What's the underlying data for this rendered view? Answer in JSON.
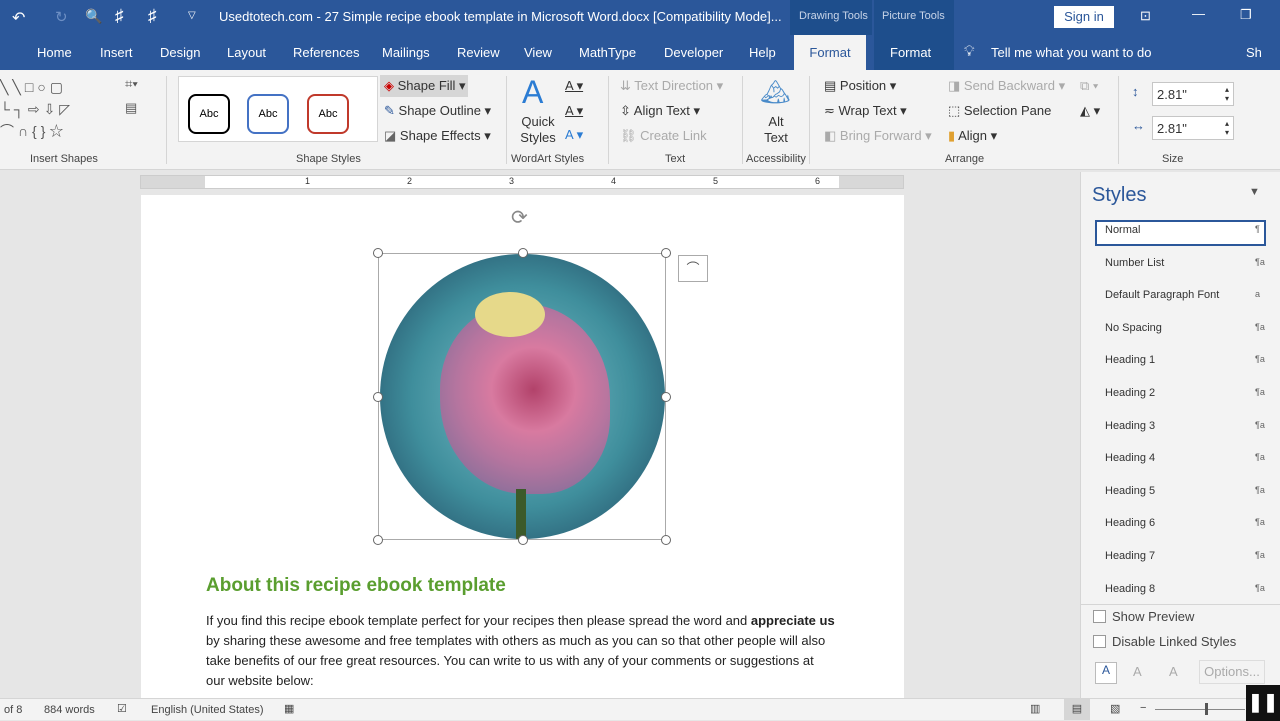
{
  "title_bar": {
    "document_title": "Usedtotech.com - 27 Simple recipe ebook template in Microsoft Word.docx [Compatibility Mode]...",
    "contextual_tabs": [
      "Drawing Tools",
      "Picture Tools"
    ],
    "sign_in": "Sign in"
  },
  "tabs": [
    "Home",
    "Insert",
    "Design",
    "Layout",
    "References",
    "Mailings",
    "Review",
    "View",
    "MathType",
    "Developer",
    "Help",
    "Format",
    "Format"
  ],
  "tell_me": "Tell me what you want to do",
  "share": "Sh",
  "ribbon": {
    "insert_shapes": "Insert Shapes",
    "shape_styles": {
      "label": "Shape Styles",
      "samples": [
        "Abc",
        "Abc",
        "Abc"
      ],
      "fill": "Shape Fill",
      "outline": "Shape Outline",
      "effects": "Shape Effects"
    },
    "wordart": {
      "label": "WordArt Styles",
      "quick_styles": "Quick Styles"
    },
    "text": {
      "label": "Text",
      "direction": "Text Direction",
      "align": "Align Text",
      "link": "Create Link"
    },
    "accessibility": {
      "label": "Accessibility",
      "alt_text": "Alt Text"
    },
    "arrange": {
      "label": "Arrange",
      "position": "Position",
      "wrap": "Wrap Text",
      "forward": "Bring Forward",
      "backward": "Send Backward",
      "selection": "Selection Pane",
      "align": "Align"
    },
    "size": {
      "label": "Size",
      "height": "2.81\"",
      "width": "2.81\""
    }
  },
  "ruler": [
    "1",
    "2",
    "3",
    "4",
    "5",
    "6"
  ],
  "document": {
    "heading": "About this recipe ebook template",
    "para_pre": "If you find this recipe ebook template perfect for your recipes then please spread the word and ",
    "para_bold": "appreciate us",
    "para_post": " by sharing these awesome and free templates with others as much as you can so that other people will also take benefits of our free great resources. You can write to us with any of your comments or suggestions at our website below:"
  },
  "styles_pane": {
    "title": "Styles",
    "items": [
      "Normal",
      "Number List",
      "Default Paragraph Font",
      "No Spacing",
      "Heading 1",
      "Heading 2",
      "Heading 3",
      "Heading 4",
      "Heading 5",
      "Heading 6",
      "Heading 7",
      "Heading 8"
    ],
    "show_preview": "Show Preview",
    "disable_linked": "Disable Linked Styles",
    "options": "Options..."
  },
  "status": {
    "page": "of 8",
    "words": "884 words",
    "language": "English (United States)"
  },
  "colors": {
    "brand": "#2b579a",
    "heading": "#5a9e2f"
  }
}
